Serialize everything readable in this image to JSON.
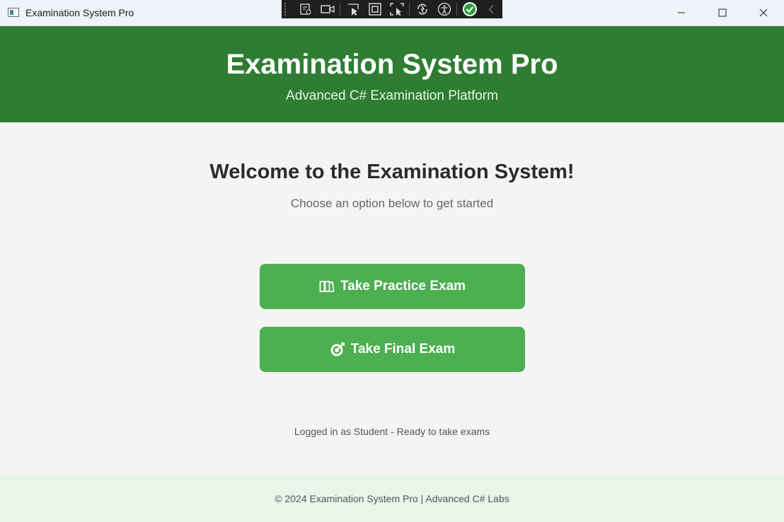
{
  "window": {
    "title": "Examination System Pro",
    "controls": [
      "minimize-icon",
      "maximize-icon",
      "close-icon"
    ]
  },
  "debug_toolbar": {
    "icons": [
      "live-visual-tree-icon",
      "record-icon",
      "select-element-icon",
      "display-layout-adorners-icon",
      "track-focus-icon",
      "hot-reload-icon",
      "accessibility-icon",
      "binding-check-icon",
      "collapse-chevron-icon"
    ]
  },
  "header": {
    "title": "Examination System Pro",
    "subtitle": "Advanced C# Examination Platform",
    "background": "#2e7d32"
  },
  "main": {
    "welcome": "Welcome to the Examination System!",
    "prompt": "Choose an option below to get started",
    "buttons": [
      {
        "label": "Take Practice Exam",
        "icon": "practice-books-icon"
      },
      {
        "label": "Take Final Exam",
        "icon": "target-icon"
      }
    ],
    "button_color": "#4caf50",
    "status": "Logged in as Student - Ready to take exams"
  },
  "footer": {
    "text": "© 2024 Examination System Pro | Advanced C# Labs",
    "background": "#e8f5e9"
  }
}
